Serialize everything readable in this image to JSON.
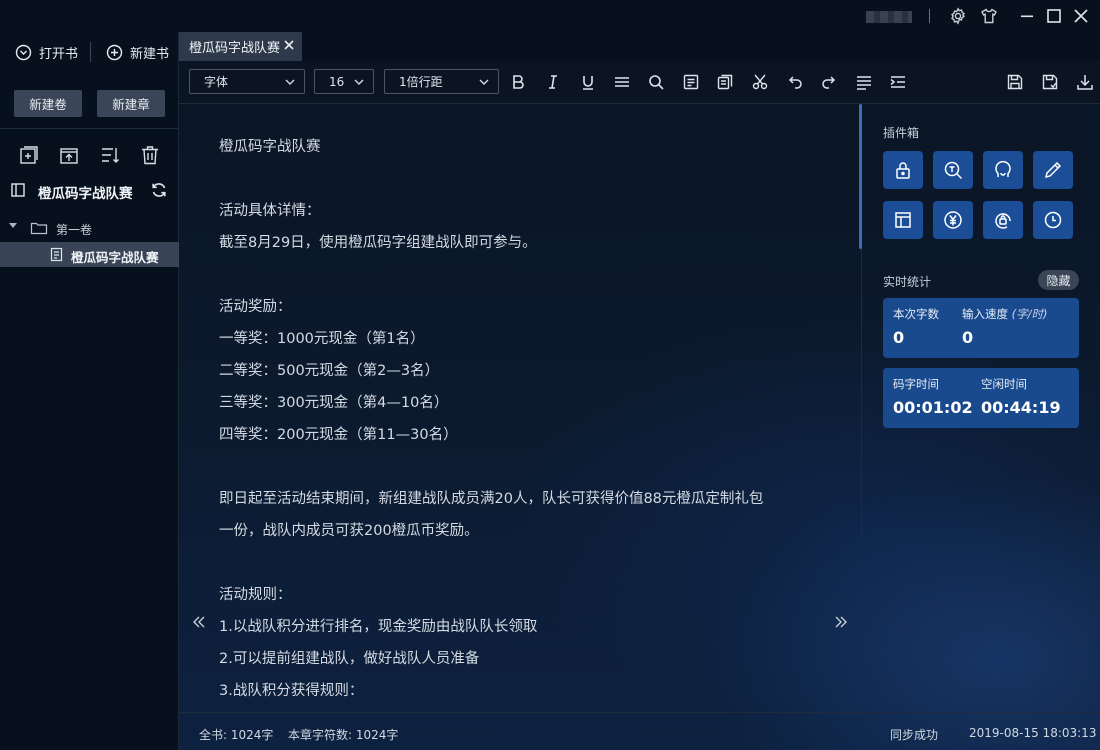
{
  "titlebar": {
    "icons": [
      "settings-icon",
      "shirt-icon",
      "minimize-icon",
      "maximize-icon",
      "close-icon"
    ]
  },
  "sidebar": {
    "open_book": "打开书",
    "new_book": "新建书",
    "new_volume": "新建卷",
    "new_chapter": "新建章",
    "tools": [
      "add-chapter-icon",
      "export-icon",
      "sort-icon",
      "trash-icon"
    ],
    "book_title": "橙瓜码字战队赛",
    "volume": "第一卷",
    "chapter": "橙瓜码字战队赛"
  },
  "tab": {
    "label": "橙瓜码字战队赛"
  },
  "toolbar": {
    "font": "字体",
    "size": "16",
    "line_spacing": "1倍行距",
    "icons": [
      "bold-icon",
      "italic-icon",
      "underline-icon",
      "strikethrough-icon",
      "search-icon",
      "notes-icon",
      "copy-icon",
      "cut-icon",
      "undo-icon",
      "redo-icon",
      "align-icon",
      "indent-icon",
      "save-icon",
      "save-as-icon",
      "download-icon"
    ]
  },
  "editor": {
    "lines": [
      "橙瓜码字战队赛",
      "",
      "活动具体详情：",
      "截至8月29日，使用橙瓜码字组建战队即可参与。",
      "",
      "活动奖励：",
      "一等奖：1000元现金（第1名）",
      "二等奖：500元现金（第2—3名）",
      "三等奖：300元现金（第4—10名）",
      "四等奖：200元现金（第11—30名）",
      "",
      "即日起至活动结束期间，新组建战队成员满20人，队长可获得价值88元橙瓜定制礼包",
      "一份，战队内成员可获200橙瓜币奖励。",
      "",
      "活动规则：",
      "1.以战队积分进行排名，现金奖励由战队队长领取",
      "2.可以提前组建战队，做好战队人员准备",
      "3.战队积分获得规则："
    ]
  },
  "plugins": {
    "title": "插件箱",
    "items": [
      "lock-icon",
      "search-word-icon",
      "head-icon",
      "pen-icon",
      "layout-icon",
      "yen-icon",
      "at-lock-icon",
      "clock-icon"
    ]
  },
  "stats": {
    "title": "实时统计",
    "hide": "隐藏",
    "session_words_label": "本次字数",
    "session_words": "0",
    "speed_label": "输入速度",
    "speed_unit": "(字/时)",
    "speed": "0",
    "typing_time_label": "码字时间",
    "typing_time": "00:01:02",
    "idle_time_label": "空闲时间",
    "idle_time": "00:44:19"
  },
  "status": {
    "book_total": "全书: 1024字",
    "chapter_chars": "本章字符数: 1024字",
    "sync": "同步成功",
    "datetime": "2019-08-15 18:03:13"
  }
}
